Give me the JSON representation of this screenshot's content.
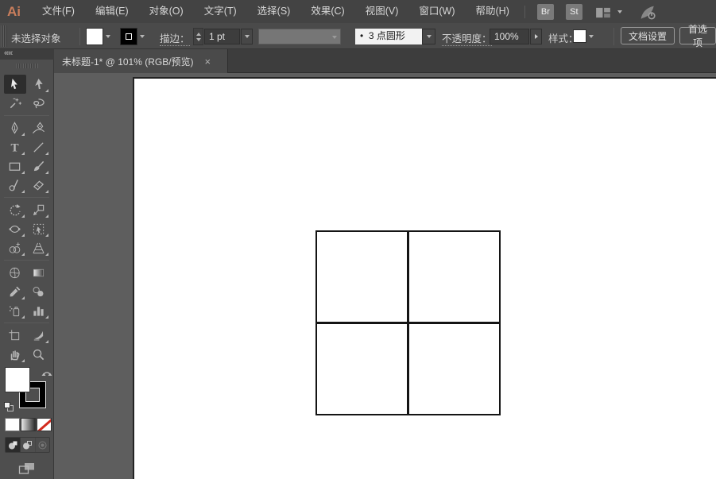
{
  "app_bar": {
    "logo_text": "Ai",
    "menus": [
      {
        "name": "menu-file",
        "label": "文件(F)"
      },
      {
        "name": "menu-edit",
        "label": "编辑(E)"
      },
      {
        "name": "menu-object",
        "label": "对象(O)"
      },
      {
        "name": "menu-type",
        "label": "文字(T)"
      },
      {
        "name": "menu-select",
        "label": "选择(S)"
      },
      {
        "name": "menu-effect",
        "label": "效果(C)"
      },
      {
        "name": "menu-view",
        "label": "视图(V)"
      },
      {
        "name": "menu-window",
        "label": "窗口(W)"
      },
      {
        "name": "menu-help",
        "label": "帮助(H)"
      }
    ],
    "bridge_label": "Br",
    "stock_label": "St"
  },
  "control_bar": {
    "status_text": "未选择对象",
    "stroke_label": "描边：",
    "stroke_weight": "1 pt",
    "brush_bullet": "•",
    "brush_name": "3 点圆形",
    "opacity_label": "不透明度：",
    "opacity_value": "100%",
    "style_label": "样式：",
    "document_setup_label": "文档设置",
    "preferences_label": "首选项"
  },
  "document_tab": {
    "title": "未标题-1* @ 101% (RGB/预览)",
    "close_glyph": "×"
  },
  "tools_panel": {
    "collapse_glyph": "««",
    "selected_tool": "selection",
    "fill_color": "#ffffff",
    "stroke_color": "#000000",
    "groups": [
      [
        {
          "icon": "selection",
          "flyout": false
        },
        {
          "icon": "direct-selection",
          "flyout": true
        },
        {
          "icon": "magic-wand",
          "flyout": false
        },
        {
          "icon": "lasso",
          "flyout": false
        }
      ],
      [
        {
          "icon": "pen",
          "flyout": true
        },
        {
          "icon": "curvature",
          "flyout": false
        },
        {
          "icon": "type",
          "flyout": true
        },
        {
          "icon": "line-segment",
          "flyout": true
        },
        {
          "icon": "rectangle",
          "flyout": true
        },
        {
          "icon": "paintbrush",
          "flyout": true
        },
        {
          "icon": "shaper",
          "flyout": true
        },
        {
          "icon": "eraser",
          "flyout": true
        }
      ],
      [
        {
          "icon": "rotate",
          "flyout": true
        },
        {
          "icon": "scale",
          "flyout": true
        },
        {
          "icon": "width",
          "flyout": true
        },
        {
          "icon": "free-transform",
          "flyout": true
        },
        {
          "icon": "shape-builder",
          "flyout": true
        },
        {
          "icon": "perspective-grid",
          "flyout": true
        }
      ],
      [
        {
          "icon": "mesh",
          "flyout": false
        },
        {
          "icon": "gradient",
          "flyout": false
        },
        {
          "icon": "eyedropper",
          "flyout": true
        },
        {
          "icon": "blend",
          "flyout": false
        },
        {
          "icon": "symbol-sprayer",
          "flyout": true
        },
        {
          "icon": "column-graph",
          "flyout": true
        }
      ],
      [
        {
          "icon": "artboard",
          "flyout": false
        },
        {
          "icon": "slice",
          "flyout": true
        },
        {
          "icon": "hand",
          "flyout": true
        },
        {
          "icon": "zoom",
          "flyout": false
        }
      ]
    ]
  },
  "canvas": {
    "pasteboard_color": "#5e5e5e",
    "artboard_color": "#ffffff",
    "grid": {
      "rows": 2,
      "cols": 2,
      "line_color": "#141414"
    }
  },
  "colors": {
    "logo_accent": "#c97e5c",
    "ui_dark": "#434343",
    "ui_panel": "#4e4e4e",
    "none_slash": "#d22a1e"
  }
}
